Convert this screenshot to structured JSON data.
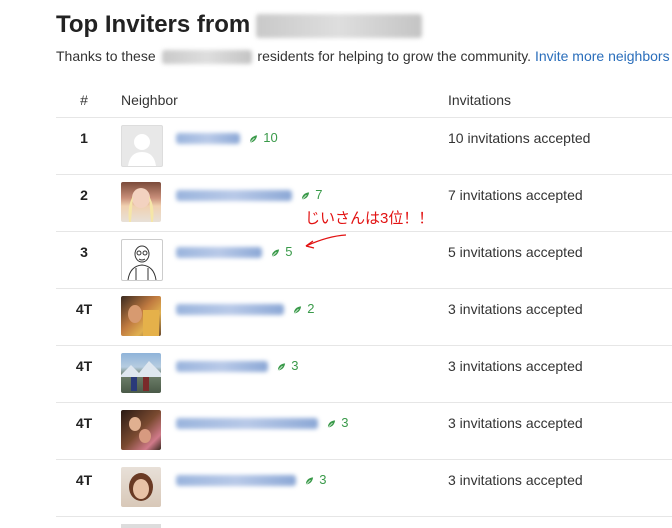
{
  "header": {
    "title": "Top Inviters from",
    "subtitle_before": "Thanks to these",
    "subtitle_after": "residents for helping to grow the community.",
    "invite_link": "Invite more neighbors"
  },
  "table": {
    "columns": [
      "#",
      "Neighbor",
      "Invitations"
    ],
    "rows": [
      {
        "rank": "1",
        "count": "10",
        "invitations": "10 invitations accepted",
        "avatar": "default-silhouette"
      },
      {
        "rank": "2",
        "count": "7",
        "invitations": "7 invitations accepted",
        "avatar": "photo"
      },
      {
        "rank": "3",
        "count": "5",
        "invitations": "5 invitations accepted",
        "avatar": "sketch"
      },
      {
        "rank": "4T",
        "count": "2",
        "invitations": "3 invitations accepted",
        "avatar": "photo"
      },
      {
        "rank": "4T",
        "count": "3",
        "invitations": "3 invitations accepted",
        "avatar": "photo"
      },
      {
        "rank": "4T",
        "count": "3",
        "invitations": "3 invitations accepted",
        "avatar": "photo"
      },
      {
        "rank": "4T",
        "count": "3",
        "invitations": "3 invitations accepted",
        "avatar": "photo"
      }
    ]
  },
  "annotation": {
    "text": "じいさんは3位！！",
    "color": "#e21212"
  },
  "colors": {
    "link": "#2a6ebb",
    "leaf_green": "#3a9a4a"
  }
}
